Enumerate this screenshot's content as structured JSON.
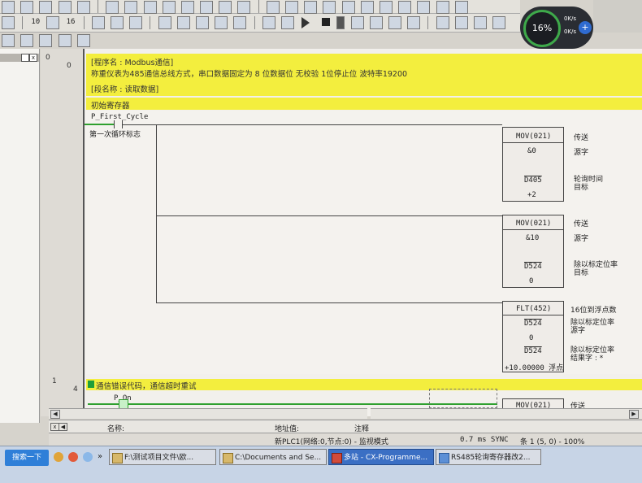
{
  "toolbar": {
    "row2_label_a": "10",
    "row2_label_b": "16"
  },
  "network_widget": {
    "percent": "16%",
    "up_rate": "0K/s",
    "down_rate": "0K/s"
  },
  "rungs": {
    "r0": {
      "number": "0",
      "step": "0",
      "program_comment": "[程序名 : Modbus通信]",
      "description": "称重仪表为485通信总线方式，串口数据固定为 8 位数据位 无校验 1位停止位 波特率19200",
      "section": "[段名称 : 读取数据]",
      "rung_comment": "初始寄存器",
      "contact_label": "P_First_Cycle",
      "contact_comment": "第一次循环标志",
      "blocks": [
        {
          "name": "MOV(021)",
          "op1": "&0",
          "op2": "D405",
          "op2_val": "+2",
          "c_type": "传送",
          "c_op1": "源字",
          "c_op2": "轮询时间\n目标"
        },
        {
          "name": "MOV(021)",
          "op1": "&10",
          "op2": "D524",
          "op2_val": "0",
          "c_type": "传送",
          "c_op1": "源字",
          "c_op2": "除以标定位率\n目标"
        },
        {
          "name": "FLT(452)",
          "op1": "D524",
          "op1_val": "0",
          "op2": "D524",
          "op2_val": "+10.00000 浮点",
          "c_type": "16位到浮点数",
          "c_op1": "除以标定位率\n源字",
          "c_op2": "除以标定位率\n结果字 : *"
        }
      ]
    },
    "r1": {
      "number": "1",
      "step": "4",
      "rung_comment": "通信错误代码，通信超时重试",
      "contact_label": "P_On",
      "next_block": "MOV(021)",
      "next_comment": "传送"
    }
  },
  "status_bar": {
    "name_label": "名称:",
    "address_label": "地址值:",
    "comment_label": "注释",
    "plc_info": "新PLC1(网络:0,节点:0) - 监视模式",
    "scan_time": "0.7 ms SYNC",
    "position": "条 1 (5, 0) - 100%"
  },
  "taskbar": {
    "start_label": "搜索一下",
    "items": [
      "F:\\测试项目文件\\欧...",
      "C:\\Documents and Se...",
      "多站 - CX-Programme...",
      "RS485轮询寄存器改2..."
    ]
  }
}
